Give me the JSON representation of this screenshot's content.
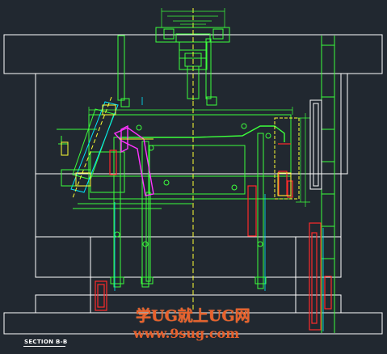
{
  "drawing": {
    "section_label": "SECTION B-B",
    "watermark_line1": "学UG就上UG网",
    "watermark_line2": "www.9sug.com",
    "colors": {
      "background": "#212830",
      "plate_outline": "#ffffff",
      "component_green": "#3cff3c",
      "cyan": "#00e6ff",
      "yellow": "#ffff33",
      "red": "#ff2a2a",
      "magenta": "#ff33ff",
      "watermark": "#e8612c"
    }
  }
}
